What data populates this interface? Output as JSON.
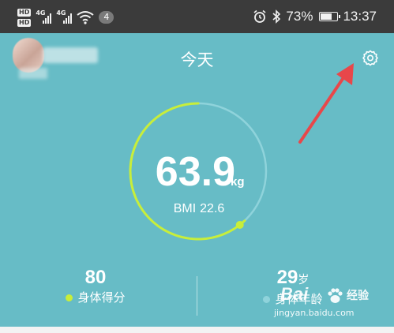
{
  "status_bar": {
    "hd_badges": [
      "HD",
      "HD"
    ],
    "network_tags": [
      "4G",
      "4G"
    ],
    "notification_count": "4",
    "battery_percent": "73%",
    "battery_level": 0.73,
    "time": "13:37",
    "icons": [
      "alarm-icon",
      "bluetooth-icon",
      "wifi-icon",
      "signal-icon"
    ]
  },
  "header": {
    "title": "今天",
    "settings_icon": "gear-icon"
  },
  "weight": {
    "value": "63.9",
    "unit": "kg",
    "bmi_label": "BMI",
    "bmi_value": "22.6",
    "ring_progress": 0.62
  },
  "stats": [
    {
      "value": "80",
      "unit": "",
      "label": "身体得分",
      "dot_color": "#c8ee3a"
    },
    {
      "value": "29",
      "unit": "岁",
      "label": "身体年龄",
      "dot_color": "#8fd3db"
    }
  ],
  "watermark": {
    "brand": "Bai",
    "brand_suffix": "经验",
    "url": "jingyan.baidu.com"
  },
  "colors": {
    "background": "#67bcc6",
    "status_bar": "#3b3b3b",
    "ring_progress": "#c8ee3a",
    "ring_track": "#8fd3db",
    "annotation_arrow": "#e8474a"
  }
}
